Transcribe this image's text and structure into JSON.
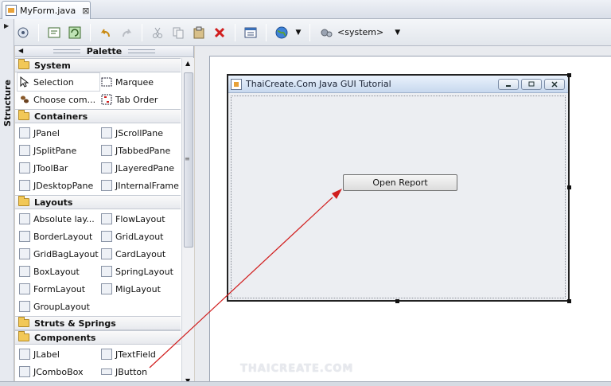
{
  "tab": {
    "label": "MyForm.java",
    "close_glyph": "⊠"
  },
  "toolbar": {
    "combo_value": "<system>"
  },
  "structure": {
    "label": "Structure"
  },
  "palette": {
    "title": "Palette",
    "categories": [
      {
        "name": "System",
        "items": [
          {
            "label": "Selection"
          },
          {
            "label": "Marquee"
          },
          {
            "label": "Choose com..."
          },
          {
            "label": "Tab Order"
          }
        ]
      },
      {
        "name": "Containers",
        "items": [
          {
            "label": "JPanel"
          },
          {
            "label": "JScrollPane"
          },
          {
            "label": "JSplitPane"
          },
          {
            "label": "JTabbedPane"
          },
          {
            "label": "JToolBar"
          },
          {
            "label": "JLayeredPane"
          },
          {
            "label": "JDesktopPane"
          },
          {
            "label": "JInternalFrame"
          }
        ]
      },
      {
        "name": "Layouts",
        "items": [
          {
            "label": "Absolute lay..."
          },
          {
            "label": "FlowLayout"
          },
          {
            "label": "BorderLayout"
          },
          {
            "label": "GridLayout"
          },
          {
            "label": "GridBagLayout"
          },
          {
            "label": "CardLayout"
          },
          {
            "label": "BoxLayout"
          },
          {
            "label": "SpringLayout"
          },
          {
            "label": "FormLayout"
          },
          {
            "label": "MigLayout"
          },
          {
            "label": "GroupLayout"
          }
        ]
      },
      {
        "name": "Struts & Springs",
        "items": []
      },
      {
        "name": "Components",
        "items": [
          {
            "label": "JLabel"
          },
          {
            "label": "JTextField"
          },
          {
            "label": "JComboBox"
          },
          {
            "label": "JButton"
          }
        ]
      }
    ]
  },
  "form": {
    "title": "ThaiCreate.Com Java GUI Tutorial",
    "button_label": "Open Report"
  },
  "watermark": "THAICREATE.COM",
  "colors": {
    "arrow": "#d11e1e",
    "title_gradient_top": "#eaf2fc",
    "selection_handle": "#111111"
  }
}
